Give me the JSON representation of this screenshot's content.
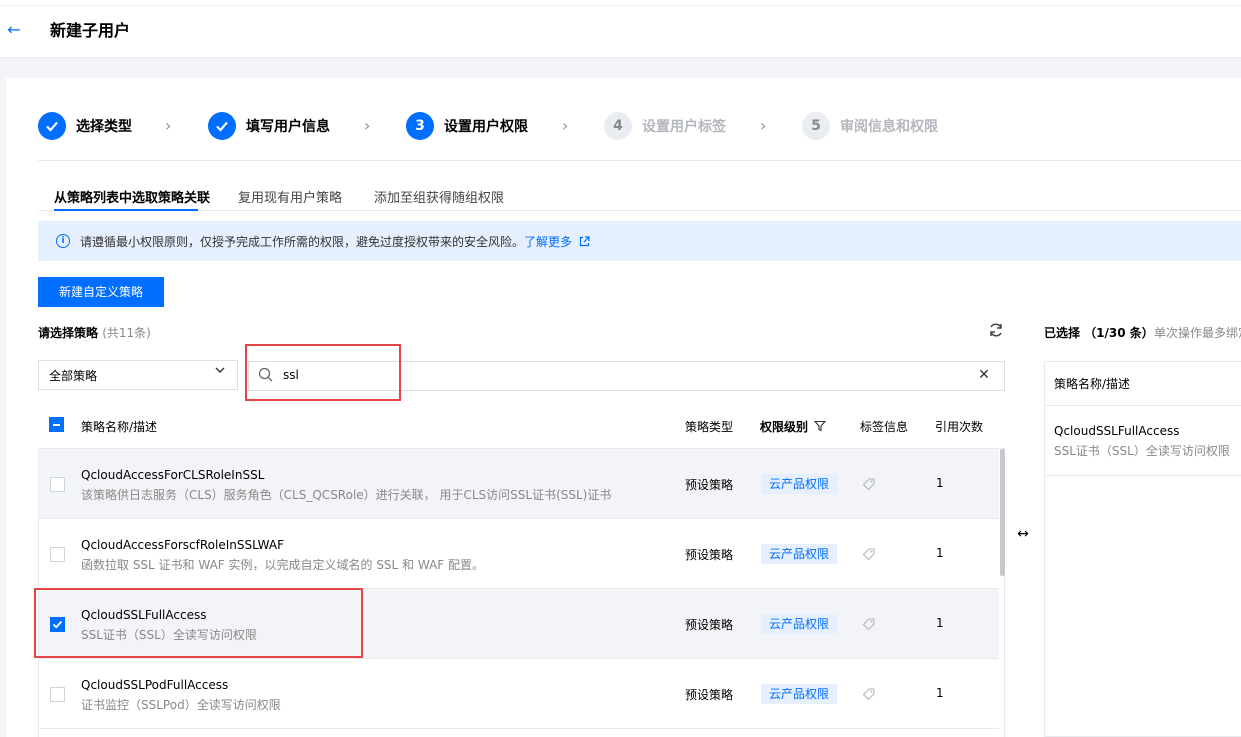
{
  "header": {
    "title": "新建子用户"
  },
  "steps": [
    {
      "label": "选择类型",
      "number": "",
      "state": "done"
    },
    {
      "label": "填写用户信息",
      "number": "",
      "state": "done"
    },
    {
      "label": "设置用户权限",
      "number": "3",
      "state": "active"
    },
    {
      "label": "设置用户标签",
      "number": "4",
      "state": "todo"
    },
    {
      "label": "审阅信息和权限",
      "number": "5",
      "state": "todo"
    }
  ],
  "tabs": [
    {
      "label": "从策略列表中选取策略关联",
      "active": true
    },
    {
      "label": "复用现有用户策略",
      "active": false
    },
    {
      "label": "添加至组获得随组权限",
      "active": false
    }
  ],
  "notice": {
    "text": "请遵循最小权限原则，仅授予完成工作所需的权限，避免过度授权带来的安全风险。",
    "link": "了解更多"
  },
  "create_button": "新建自定义策略",
  "policy_section": {
    "label": "请选择策略",
    "count": "(共11条)"
  },
  "filter": {
    "selected": "全部策略"
  },
  "search": {
    "value": "ssl"
  },
  "table": {
    "columns": [
      "策略名称/描述",
      "策略类型",
      "权限级别",
      "标签信息",
      "引用次数"
    ],
    "rows": [
      {
        "name": "QcloudAccessForCLSRoleInSSL",
        "desc": "该策略供日志服务（CLS）服务角色（CLS_QCSRole）进行关联， 用于CLS访问SSL证书(SSL)证书",
        "type": "预设策略",
        "level": "云产品权限",
        "refs": "1",
        "checked": false
      },
      {
        "name": "QcloudAccessForscfRoleInSSLWAF",
        "desc": "函数拉取 SSL 证书和 WAF 实例，以完成自定义域名的 SSL 和 WAF 配置。",
        "type": "预设策略",
        "level": "云产品权限",
        "refs": "1",
        "checked": false
      },
      {
        "name": "QcloudSSLFullAccess",
        "desc": "SSL证书（SSL）全读写访问权限",
        "type": "预设策略",
        "level": "云产品权限",
        "refs": "1",
        "checked": true
      },
      {
        "name": "QcloudSSLPodFullAccess",
        "desc": "证书监控（SSLPod）全读写访问权限",
        "type": "预设策略",
        "level": "云产品权限",
        "refs": "1",
        "checked": false
      }
    ]
  },
  "selected_panel": {
    "title": "已选择 （1/30 条）",
    "hint": "单次操作最多绑定",
    "column": "策略名称/描述",
    "items": [
      {
        "name": "QcloudSSLFullAccess",
        "desc": "SSL证书（SSL）全读写访问权限"
      }
    ]
  },
  "colors": {
    "accent": "#006eff",
    "highlight": "#e54545"
  }
}
